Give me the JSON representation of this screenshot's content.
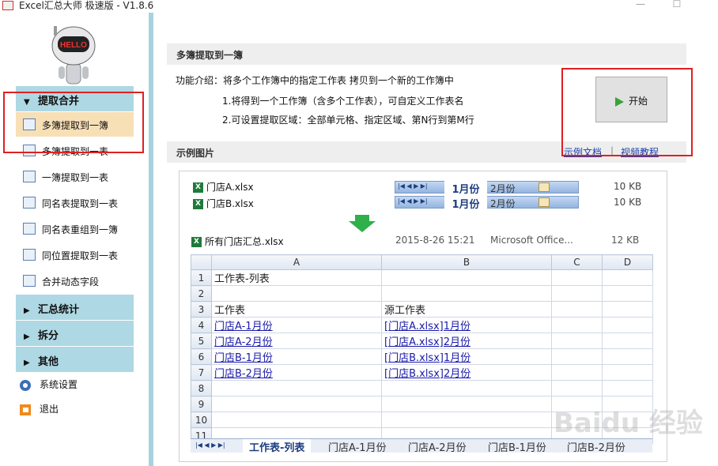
{
  "window": {
    "title": "Excel汇总大师 极速版 - V1.8.6",
    "minimize": "—",
    "maximize": "☐"
  },
  "robot": {
    "badge": "HELLO"
  },
  "sidebar": {
    "sections": [
      {
        "label": "提取合并",
        "arrow": "▼"
      },
      {
        "label": "汇总统计",
        "arrow": "▶"
      },
      {
        "label": "拆分",
        "arrow": "▶"
      },
      {
        "label": "其他",
        "arrow": "▶"
      }
    ],
    "items": [
      {
        "label": "多簿提取到一簿"
      },
      {
        "label": "多簿提取到一表"
      },
      {
        "label": "一簿提取到一表"
      },
      {
        "label": "同名表提取到一表"
      },
      {
        "label": "同名表重组到一簿"
      },
      {
        "label": "同位置提取到一表"
      },
      {
        "label": "合并动态字段"
      }
    ],
    "settings": "系统设置",
    "exit": "退出"
  },
  "main": {
    "header": "多簿提取到一簿",
    "intro": "功能介绍：将多个工作簿中的指定工作表 拷贝到一个新的工作簿中",
    "point1": "1.将得到一个工作簿（含多个工作表），可自定义工作表名",
    "point2": "2.可设置提取区域：全部单元格、指定区域、第N行到第M行",
    "start_label": "开始",
    "example_header": "示例图片",
    "doc_link": "示例文档",
    "separator": "|",
    "video_link": "视频教程"
  },
  "example": {
    "files": [
      {
        "name": "门店A.xlsx",
        "tab1": "1月份",
        "tab2": "2月份",
        "size": "10 KB"
      },
      {
        "name": "门店B.xlsx",
        "tab1": "1月份",
        "tab2": "2月份",
        "size": "10 KB"
      }
    ],
    "result": {
      "name": "所有门店汇总.xlsx",
      "date": "2015-8-26 15:21",
      "type": "Microsoft Office...",
      "size": "12 KB"
    },
    "tab_nav": "|◀ ◀ ▶ ▶|",
    "columns": [
      "A",
      "B",
      "C",
      "D"
    ],
    "rows": [
      {
        "n": "1",
        "a": "工作表-列表",
        "b": "",
        "link": false
      },
      {
        "n": "2",
        "a": "",
        "b": "",
        "link": false
      },
      {
        "n": "3",
        "a": "工作表",
        "b": "源工作表",
        "link": false
      },
      {
        "n": "4",
        "a": "门店A-1月份",
        "b": "[门店A.xlsx]1月份",
        "link": true
      },
      {
        "n": "5",
        "a": "门店A-2月份",
        "b": "[门店A.xlsx]2月份",
        "link": true
      },
      {
        "n": "6",
        "a": "门店B-1月份",
        "b": "[门店B.xlsx]1月份",
        "link": true
      },
      {
        "n": "7",
        "a": "门店B-2月份",
        "b": "[门店B.xlsx]2月份",
        "link": true
      },
      {
        "n": "8",
        "a": "",
        "b": "",
        "link": false
      },
      {
        "n": "9",
        "a": "",
        "b": "",
        "link": false
      },
      {
        "n": "10",
        "a": "",
        "b": "",
        "link": false
      },
      {
        "n": "11",
        "a": "",
        "b": "",
        "link": false
      }
    ],
    "sheet_tabs": [
      "工作表-列表",
      "门店A-1月份",
      "门店A-2月份",
      "门店B-1月份",
      "门店B-2月份"
    ],
    "watermark": "Baidu 经验"
  }
}
